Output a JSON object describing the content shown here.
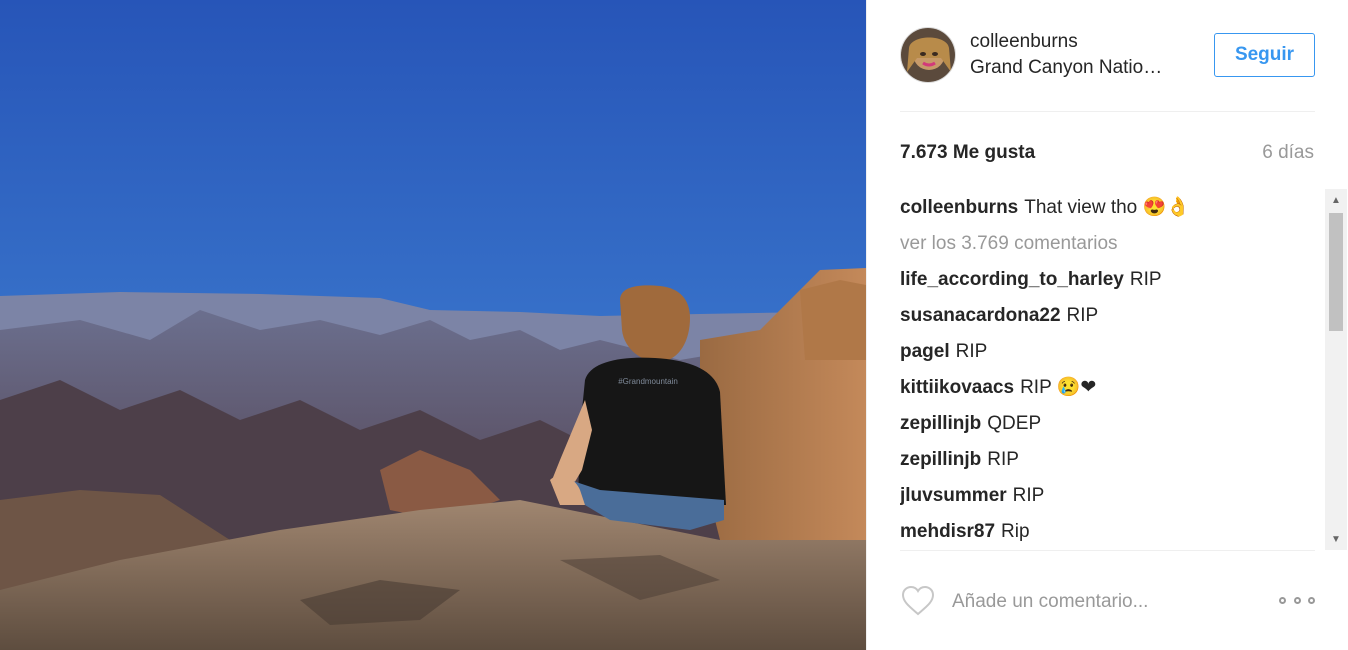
{
  "post": {
    "username": "colleenburns",
    "location": "Grand Canyon Natio…",
    "follow_label": "Seguir",
    "likes": "7.673 Me gusta",
    "age": "6 días"
  },
  "caption": {
    "user": "colleenburns",
    "text": "That view tho 😍👌"
  },
  "view_comments": "ver los 3.769 comentarios",
  "comments": [
    {
      "user": "life_according_to_harley",
      "text": "RIP"
    },
    {
      "user": "susanacardona22",
      "text": "RIP"
    },
    {
      "user": "pagel",
      "text": "RIP"
    },
    {
      "user": "kittiikovaacs",
      "text": "RIP 😢❤"
    },
    {
      "user": "zepillinjb",
      "text": "QDEP"
    },
    {
      "user": "zepillinjb",
      "text": "RIP"
    },
    {
      "user": "jluvsummer",
      "text": "RIP"
    },
    {
      "user": "mehdisr87",
      "text": "Rip"
    }
  ],
  "add_comment": {
    "placeholder": "Añade un comentario..."
  },
  "icons": {
    "like": "heart-icon",
    "more": "more-options-icon"
  },
  "colors": {
    "accent": "#3897f0",
    "sky": "#2a66c4"
  }
}
